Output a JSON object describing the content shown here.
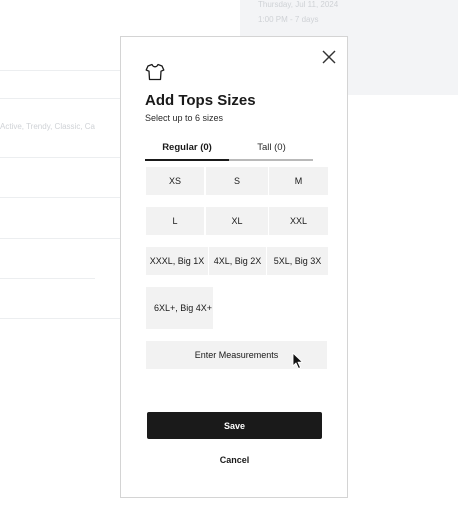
{
  "background": {
    "texts": [
      "Thursday, Jul 11, 2024",
      "1:00 PM - 7 days",
      "Active, Trendy, Classic, Ca"
    ]
  },
  "modal": {
    "close_icon": "close-icon",
    "header_icon": "shirt-icon",
    "title": "Add Tops Sizes",
    "subtitle": "Select up to 6 sizes",
    "tabs": [
      {
        "label": "Regular (0)",
        "active": true
      },
      {
        "label": "Tall (0)",
        "active": false
      }
    ],
    "sizes": [
      "XS",
      "S",
      "M",
      "L",
      "XL",
      "XXL",
      "XXXL, Big 1X",
      "4XL, Big 2X",
      "5XL, Big 3X",
      "6XL+, Big 4X+"
    ],
    "enter_measurements_label": "Enter Measurements",
    "save_label": "Save",
    "cancel_label": "Cancel"
  },
  "colors": {
    "primary": "#1a1a1a",
    "chip_bg": "#f2f2f2",
    "tab_inactive_line": "#b9b9b9"
  }
}
